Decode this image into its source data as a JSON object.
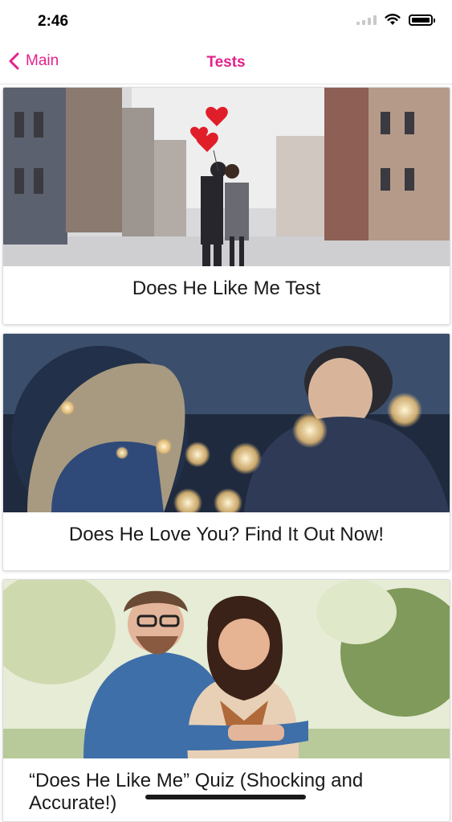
{
  "status": {
    "time": "2:46"
  },
  "nav": {
    "back_label": "Main",
    "title": "Tests"
  },
  "colors": {
    "accent": "#e3218d"
  },
  "icons": {
    "back": "chevron-left-icon",
    "wifi": "wifi-icon",
    "battery": "battery-icon",
    "signal": "signal-icon"
  },
  "tests": [
    {
      "title": "Does He Like Me Test",
      "image": "couple kissing on city street with red heart balloons"
    },
    {
      "title": "Does He Love You? Find It Out Now!",
      "image": "couple at night with bokeh lights"
    },
    {
      "title": "“Does He Like Me” Quiz (Shocking and Accurate!)",
      "image": "smiling couple embracing outdoors"
    }
  ]
}
